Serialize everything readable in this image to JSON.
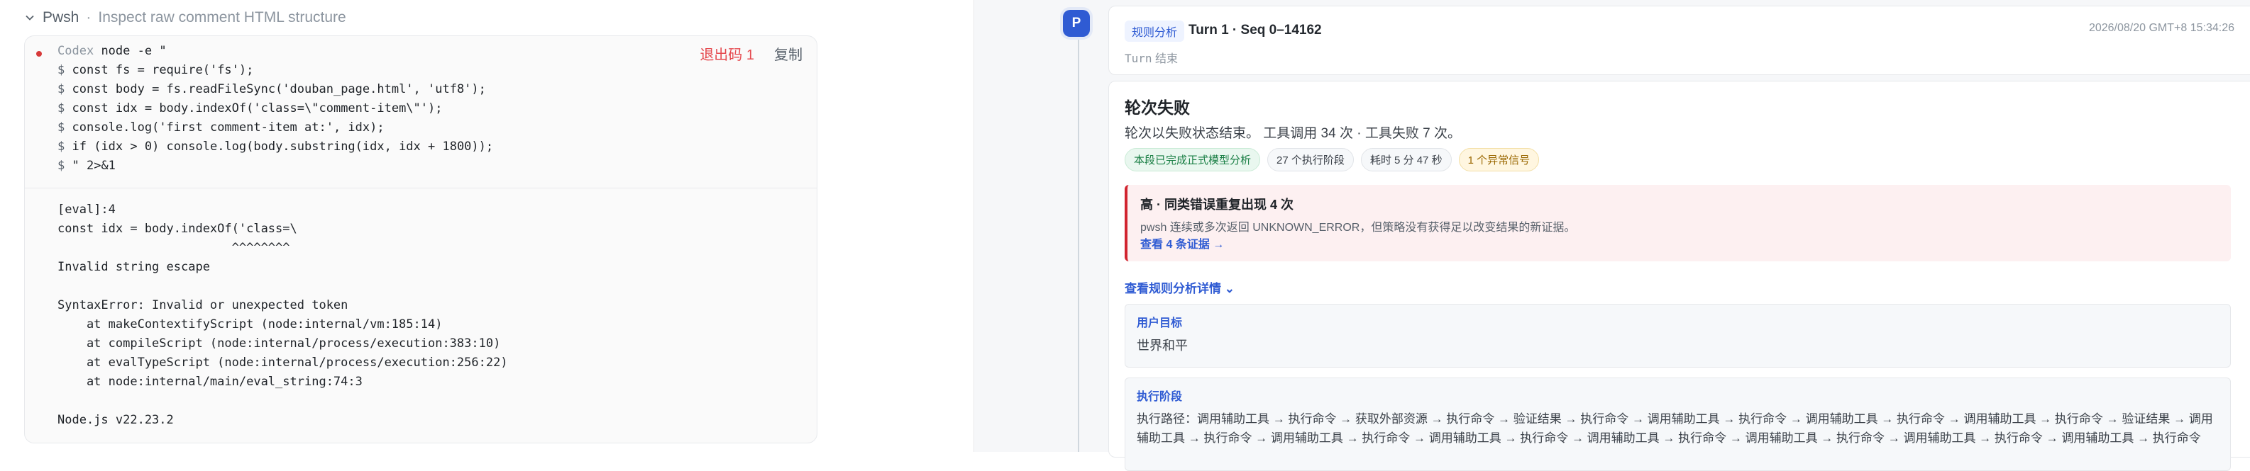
{
  "command": {
    "tool": "Pwsh",
    "separator": "·",
    "description": "Inspect raw comment HTML structure",
    "exit_label": "退出码 1",
    "copy_label": "复制",
    "prefix": "Codex",
    "first_line": "node -e \"",
    "prompt": "$",
    "lines": [
      "const fs = require('fs');",
      "const body = fs.readFileSync('douban_page.html', 'utf8');",
      "const idx = body.indexOf('class=\\\"comment-item\\\"');",
      "console.log('first comment-item at:', idx);",
      "if (idx > 0) console.log(body.substring(idx, idx + 1800));",
      "\" 2>&1"
    ],
    "output": "[eval]:4\nconst idx = body.indexOf('class=\\\n                        ^^^^^^^^\nInvalid string escape\n\nSyntaxError: Invalid or unexpected token\n    at makeContextifyScript (node:internal/vm:185:14)\n    at compileScript (node:internal/process/execution:383:10)\n    at evalTypeScript (node:internal/process/execution:256:22)\n    at node:internal/main/eval_string:74:3\n\nNode.js v22.23.2"
  },
  "turn": {
    "avatar": "P",
    "badge": "规则分析",
    "title": "Turn 1 · Seq 0–14162",
    "date": "2026/08/20 GMT+8 15:34:26",
    "status_key": "Turn",
    "status_value": "结束"
  },
  "analysis": {
    "title": "轮次失败",
    "summary": "轮次以失败状态结束。 工具调用 34 次 · 工具失败 7 次。",
    "chips": [
      "本段已完成正式模型分析",
      "27 个执行阶段",
      "耗时 5 分 47 秒",
      "1 个异常信号"
    ],
    "alert": {
      "title": "高 · 同类错误重复出现 4 次",
      "body": "pwsh 连续或多次返回 UNKNOWN_ERROR，但策略没有获得足以改变结果的新证据。",
      "link": "查看 4 条证据 →"
    },
    "details_link": "查看规则分析详情 ⌄",
    "goal_label": "用户目标",
    "goal_value": "世界和平",
    "phase_label": "执行阶段",
    "phase_path": "执行路径：调用辅助工具 → 执行命令 → 获取外部资源 → 执行命令 → 验证结果 → 执行命令 → 调用辅助工具 → 执行命令 → 调用辅助工具 → 执行命令 → 调用辅助工具 → 执行命令 → 验证结果 → 调用辅助工具 → 执行命令 → 调用辅助工具 → 执行命令 → 调用辅助工具 → 执行命令 → 调用辅助工具 → 执行命令 → 调用辅助工具 → 执行命令 → 调用辅助工具 → 执行命令 → 调用辅助工具 → 执行命令"
  },
  "colors": {
    "accent": "#2f5bd3",
    "error": "#e5484d",
    "success": "#1a7f45",
    "warning": "#9a6700"
  }
}
